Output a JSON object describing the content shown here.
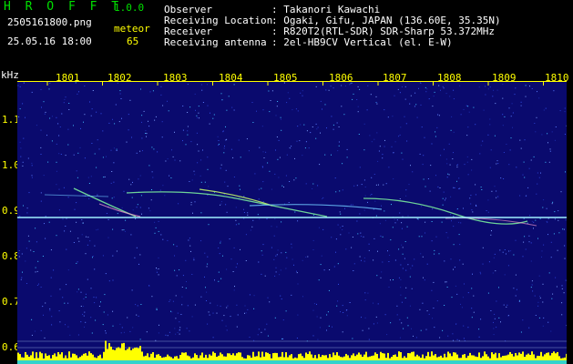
{
  "app": {
    "title": "H R O F F T",
    "version": "1.0.0"
  },
  "file": {
    "name": "2505161800.png",
    "timestamp": "25.05.16 18:00"
  },
  "meteor": {
    "label": "meteor",
    "count": "65"
  },
  "info": [
    {
      "key": "Observer",
      "value": ": Takanori Kawachi"
    },
    {
      "key": "Receiving Location",
      "value": ": Ogaki, Gifu, JAPAN (136.60E, 35.35N)"
    },
    {
      "key": "Receiver",
      "value": ": R820T2(RTL-SDR) SDR-Sharp 53.372MHz"
    },
    {
      "key": "Receiving antenna",
      "value": ": 2el-HB9CV Vertical (el. E-W)"
    }
  ],
  "axes": {
    "unit": "kHz",
    "x_ticks": [
      "1801",
      "1802",
      "1803",
      "1804",
      "1805",
      "1806",
      "1807",
      "1808",
      "1809",
      "1810"
    ],
    "y_ticks": [
      "1.1",
      "1.0",
      "0.9",
      "0.8",
      "0.7",
      "0.6"
    ]
  },
  "colors": {
    "background": "#0a0a6e",
    "tick": "#ffff00",
    "title": "#00e000",
    "carrier": "#9ff0ff",
    "echo": "#7ff7a0",
    "level": "#ffff00"
  }
}
